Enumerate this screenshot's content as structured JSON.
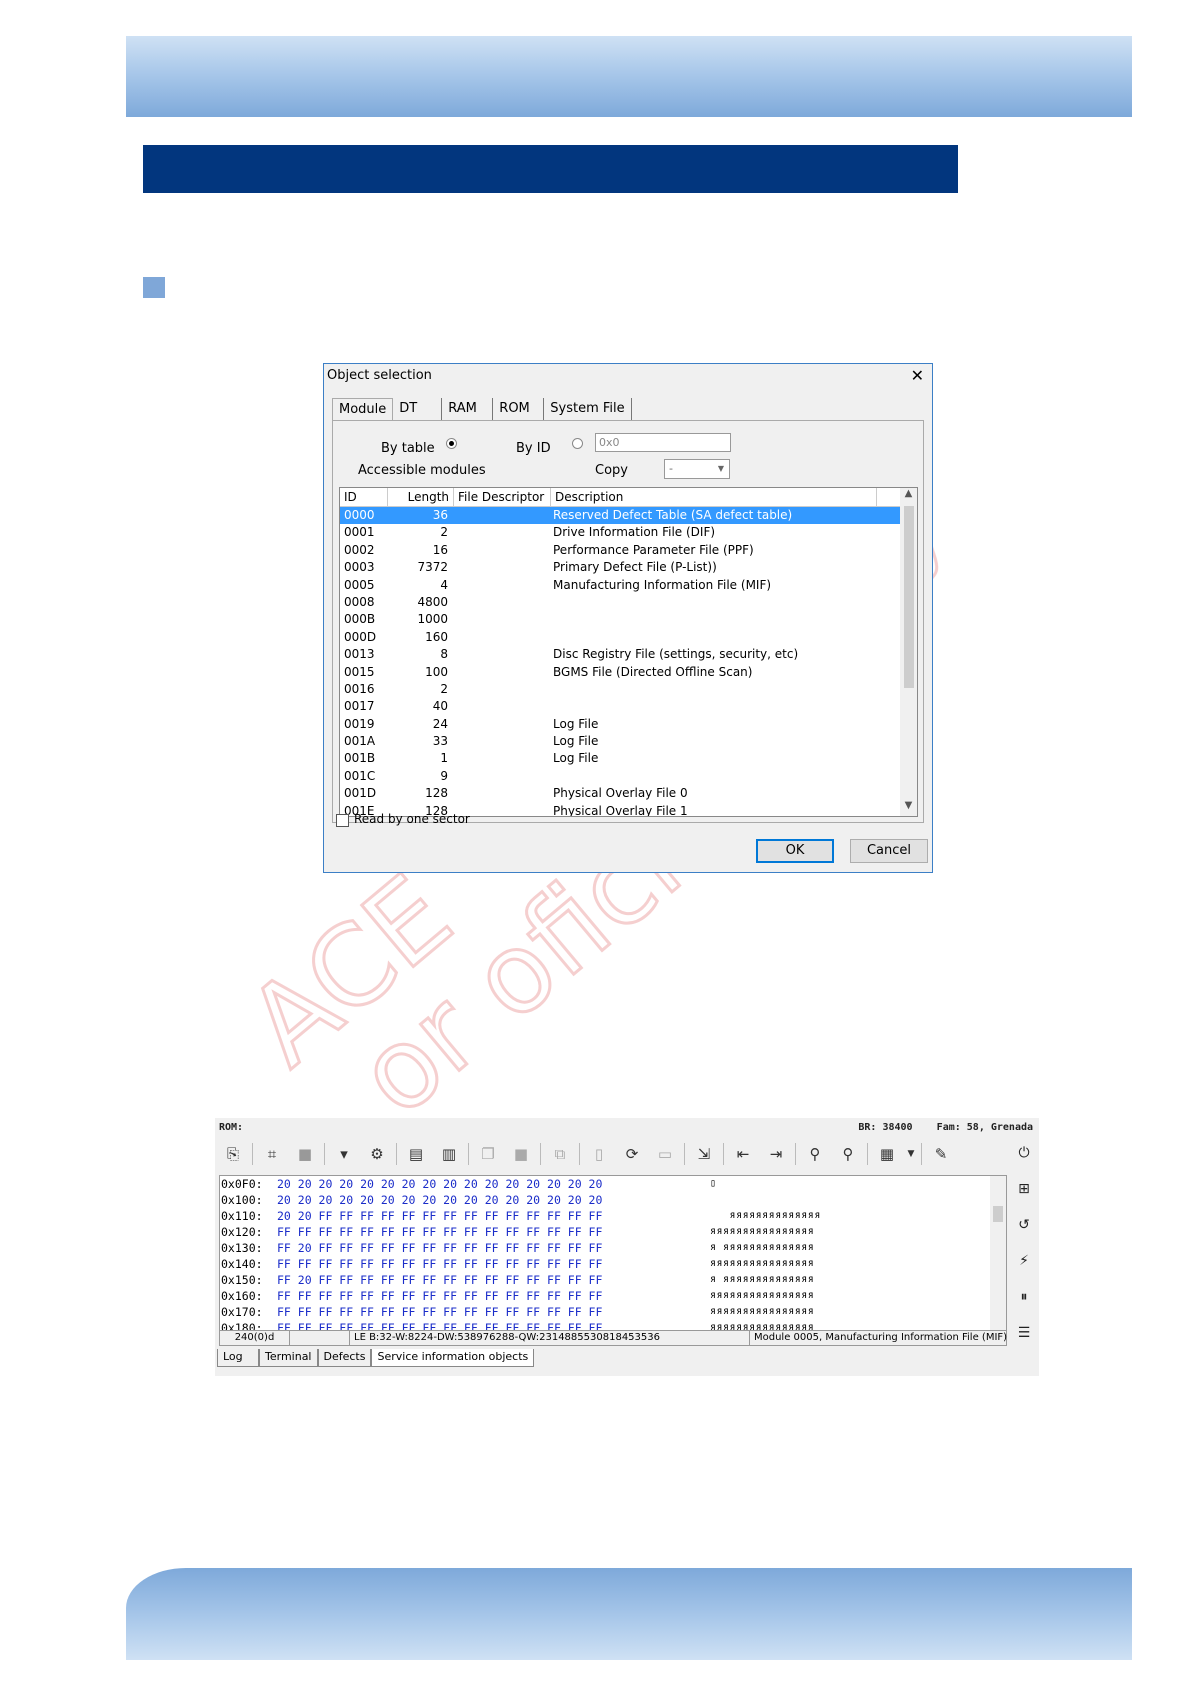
{
  "dialog": {
    "title": "Object selection",
    "tabs": [
      "Module",
      "DT",
      "RAM",
      "ROM",
      "System File"
    ],
    "by_table_label": "By table",
    "by_id_label": "By ID",
    "id_value": "0x0",
    "accessible_modules_label": "Accessible modules",
    "copy_label": "Copy",
    "copy_value": "-",
    "columns": [
      "ID",
      "Length",
      "File Descriptor",
      "Description"
    ],
    "rows": [
      {
        "id": "0000",
        "length": "36",
        "fd": "",
        "desc": "Reserved Defect Table (SA defect table)"
      },
      {
        "id": "0001",
        "length": "2",
        "fd": "",
        "desc": "Drive Information File (DIF)"
      },
      {
        "id": "0002",
        "length": "16",
        "fd": "",
        "desc": "Performance Parameter File (PPF)"
      },
      {
        "id": "0003",
        "length": "7372",
        "fd": "",
        "desc": "Primary Defect File (P-List))"
      },
      {
        "id": "0005",
        "length": "4",
        "fd": "",
        "desc": "Manufacturing Information File (MIF)"
      },
      {
        "id": "0008",
        "length": "4800",
        "fd": "",
        "desc": ""
      },
      {
        "id": "000B",
        "length": "1000",
        "fd": "",
        "desc": ""
      },
      {
        "id": "000D",
        "length": "160",
        "fd": "",
        "desc": ""
      },
      {
        "id": "0013",
        "length": "8",
        "fd": "",
        "desc": "Disc Registry File (settings, security, etc)"
      },
      {
        "id": "0015",
        "length": "100",
        "fd": "",
        "desc": "BGMS File (Directed Offline Scan)"
      },
      {
        "id": "0016",
        "length": "2",
        "fd": "",
        "desc": ""
      },
      {
        "id": "0017",
        "length": "40",
        "fd": "",
        "desc": ""
      },
      {
        "id": "0019",
        "length": "24",
        "fd": "",
        "desc": "Log File"
      },
      {
        "id": "001A",
        "length": "33",
        "fd": "",
        "desc": "Log File"
      },
      {
        "id": "001B",
        "length": "1",
        "fd": "",
        "desc": "Log File"
      },
      {
        "id": "001C",
        "length": "9",
        "fd": "",
        "desc": ""
      },
      {
        "id": "001D",
        "length": "128",
        "fd": "",
        "desc": "Physical Overlay File 0"
      },
      {
        "id": "001E",
        "length": "128",
        "fd": "",
        "desc": "Physical Overlay File 1"
      }
    ],
    "read_by_sector_label": "Read by one sector",
    "ok_label": "OK",
    "cancel_label": "Cancel"
  },
  "rom": {
    "title": "ROM:",
    "br": "BR: 38400",
    "fam": "Fam: 58, Grenada",
    "hex_rows": [
      {
        "addr": "0x0F0:",
        "bytes": "20 20 20 20 20 20 20 20 20 20 20 20 20 20 20 20",
        "ascii": "▯"
      },
      {
        "addr": "0x100:",
        "bytes": "20 20 20 20 20 20 20 20 20 20 20 20 20 20 20 20",
        "ascii": ""
      },
      {
        "addr": "0x110:",
        "bytes": "20 20 FF FF FF FF FF FF FF FF FF FF FF FF FF FF",
        "ascii": "   яяяяяяяяяяяяяя"
      },
      {
        "addr": "0x120:",
        "bytes": "FF FF FF FF FF FF FF FF FF FF FF FF FF FF FF FF",
        "ascii": "яяяяяяяяяяяяяяяя"
      },
      {
        "addr": "0x130:",
        "bytes": "FF 20 FF FF FF FF FF FF FF FF FF FF FF FF FF FF",
        "ascii": "я яяяяяяяяяяяяяя"
      },
      {
        "addr": "0x140:",
        "bytes": "FF FF FF FF FF FF FF FF FF FF FF FF FF FF FF FF",
        "ascii": "яяяяяяяяяяяяяяяя"
      },
      {
        "addr": "0x150:",
        "bytes": "FF 20 FF FF FF FF FF FF FF FF FF FF FF FF FF FF",
        "ascii": "я яяяяяяяяяяяяяя"
      },
      {
        "addr": "0x160:",
        "bytes": "FF FF FF FF FF FF FF FF FF FF FF FF FF FF FF FF",
        "ascii": "яяяяяяяяяяяяяяяя"
      },
      {
        "addr": "0x170:",
        "bytes": "FF FF FF FF FF FF FF FF FF FF FF FF FF FF FF FF",
        "ascii": "яяяяяяяяяяяяяяяя"
      },
      {
        "addr": "0x180:",
        "bytes": "FF FF FF FF FF FF FF FF FF FF FF FF FF FF FF FF",
        "ascii": "яяяяяяяяяяяяяяяя"
      }
    ],
    "status": [
      "240(0)d",
      "",
      "LE B:32-W:8224-DW:538976288-QW:2314885530818453536",
      "Module 0005, Manufacturing Information File (MIF)"
    ],
    "tabs": [
      "Log",
      "Terminal",
      "Defects",
      "Service information objects"
    ]
  },
  "watermark": {
    "line1": "ACE",
    "line2": "or oficial",
    "line3": "ty"
  }
}
